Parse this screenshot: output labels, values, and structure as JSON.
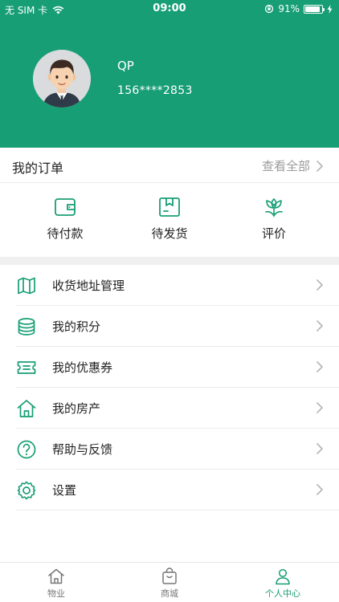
{
  "status_bar": {
    "carrier": "无 SIM 卡",
    "time": "09:00",
    "battery": "91%",
    "battery_level": 0.91,
    "icons": [
      "wifi-icon",
      "orientation-lock-icon",
      "battery-icon",
      "charging-icon"
    ]
  },
  "profile": {
    "name": "QP",
    "phone": "156****2853"
  },
  "orders": {
    "title": "我的订单",
    "view_all": "查看全部",
    "items": [
      {
        "label": "待付款",
        "icon": "wallet-icon"
      },
      {
        "label": "待发货",
        "icon": "box-icon"
      },
      {
        "label": "评价",
        "icon": "flower-icon"
      }
    ]
  },
  "menu": [
    {
      "label": "收货地址管理",
      "icon": "map-icon"
    },
    {
      "label": "我的积分",
      "icon": "coins-icon"
    },
    {
      "label": "我的优惠券",
      "icon": "ticket-icon"
    },
    {
      "label": "我的房产",
      "icon": "house-icon"
    },
    {
      "label": "帮助与反馈",
      "icon": "help-icon"
    },
    {
      "label": "设置",
      "icon": "settings-gear-icon"
    }
  ],
  "tabbar": {
    "tabs": [
      {
        "label": "物业",
        "icon": "home-icon",
        "active": false
      },
      {
        "label": "商城",
        "icon": "shopping-bag-icon",
        "active": false
      },
      {
        "label": "个人中心",
        "icon": "person-icon",
        "active": true
      }
    ]
  },
  "colors": {
    "brand": "#179e74",
    "divider": "#ebebeb",
    "muted_text": "#9a9a9a"
  }
}
